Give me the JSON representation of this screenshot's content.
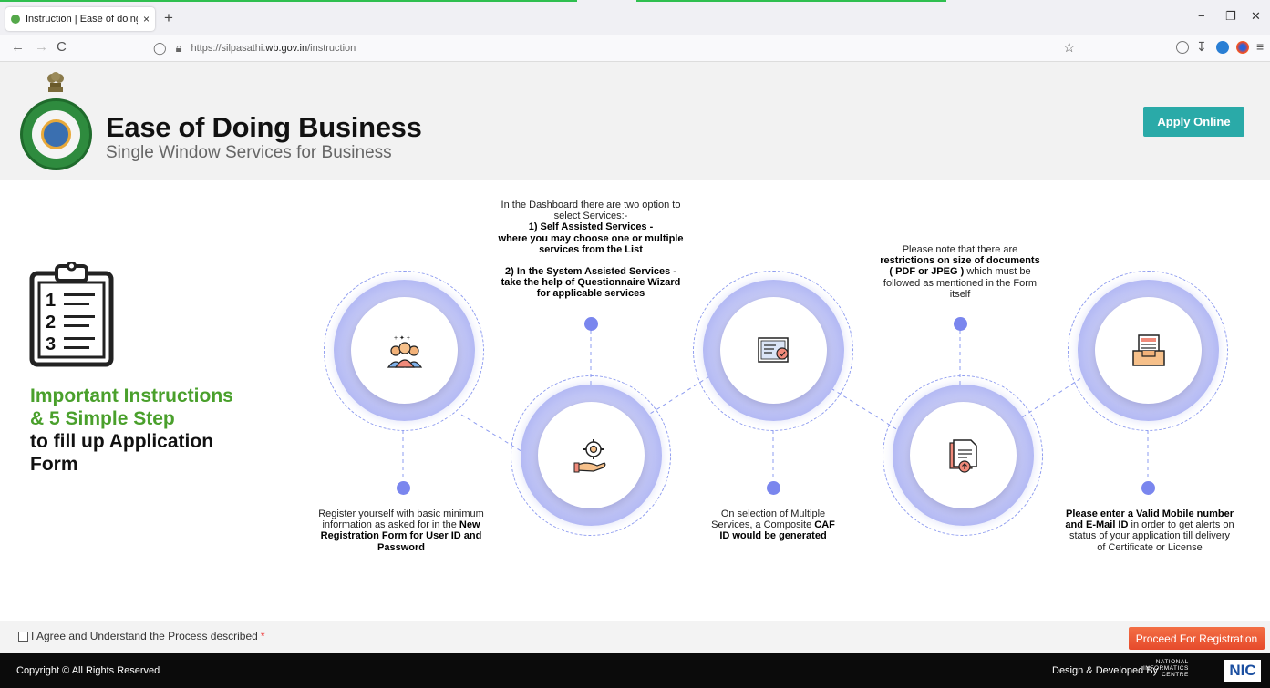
{
  "browser": {
    "tab_title": "Instruction | Ease of doing busin",
    "tab_close": "×",
    "new_tab": "+",
    "url_prefix": "https://silpasathi.",
    "url_domain": "wb.gov.in",
    "url_path": "/instruction",
    "controls": {
      "minimize": "−",
      "restore": "❐",
      "close": "✕"
    },
    "nav": {
      "back": "←",
      "forward": "→",
      "reload": "C"
    },
    "icons": [
      "shield-icon",
      "lock-icon",
      "star-icon",
      "pocket-icon",
      "download-icon",
      "extension-icon",
      "profile-icon",
      "menu-icon"
    ]
  },
  "header": {
    "title": "Ease of Doing Business",
    "subtitle": "Single Window Services for Business",
    "apply_button": "Apply Online",
    "accent": "#2aaaa8"
  },
  "intro": {
    "line1": "Important Instructions",
    "line2": "& 5 Simple Step",
    "line3": "to fill up Application",
    "line4": "Form",
    "accent": "#4aa02c",
    "clipboard_numbers": [
      "1",
      "2",
      "3"
    ]
  },
  "steps": {
    "step1": {
      "icon": "team-icon",
      "pre": "Register yourself with basic minimum information as asked for in the ",
      "bold": "New Registration Form for User ID and Password"
    },
    "step2": {
      "icon": "service-gear-icon",
      "l1": "In the Dashboard there are two option to",
      "l2": "select Services:-",
      "b1": "1) Self Assisted Services -",
      "b2": "where you may choose one or multiple",
      "b3": "services from the List",
      "b4": "2) In the System Assisted Services -",
      "b5": "take the help of Questionnaire Wizard",
      "b6": "for applicable services"
    },
    "step3": {
      "icon": "certificate-icon",
      "l1": "On selection of Multiple",
      "l2": "Services, a Composite ",
      "b1": "CAF",
      "b2": "ID would be generated"
    },
    "step4": {
      "icon": "document-upload-icon",
      "l1": "Please note that there are",
      "b1": "restrictions on size of documents",
      "b2": "( PDF or JPEG )",
      "l2": " which must be",
      "l3": "followed as mentioned in the Form",
      "l4": "itself"
    },
    "step5": {
      "icon": "inbox-tray-icon",
      "b1": "Please enter a Valid Mobile number",
      "b2": "and E-Mail ID",
      "l1": " in order to get alerts on",
      "l2": "status of your application till delivery",
      "l3": "of Certificate or License"
    },
    "colors": {
      "ring": "#8e97f0",
      "dot": "#7a86ee",
      "dash": "#8e9cf0"
    }
  },
  "agree": {
    "label": "I Agree and Understand the Process described",
    "required": "*",
    "proceed_button": "Proceed For Registration",
    "button_color": "#f15a3a"
  },
  "footer": {
    "copyright": "Copyright © All Rights Reserved",
    "developed_by": "Design & Developed By",
    "nic_l1": "NATIONAL",
    "nic_l2": "INFORMATICS",
    "nic_l3": "CENTRE",
    "nic_logo": "NIC"
  }
}
